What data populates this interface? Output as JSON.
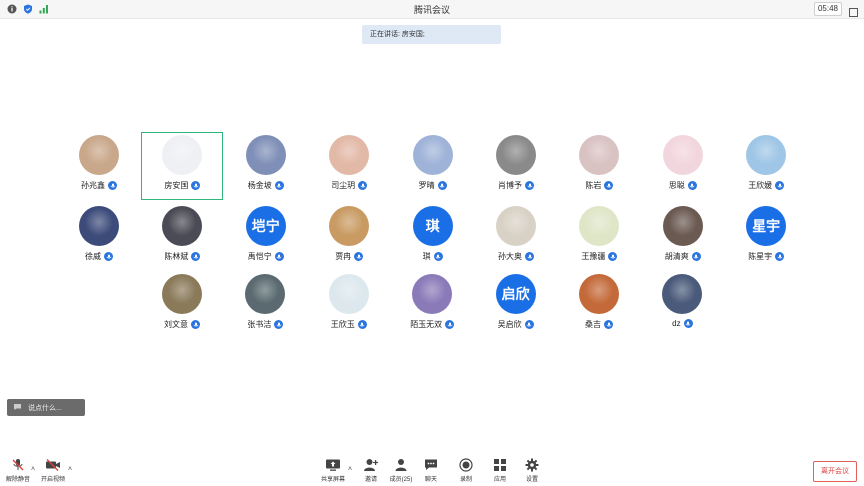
{
  "window": {
    "title": "腾讯会议",
    "timer": "05:48"
  },
  "speaking": {
    "text": "正在讲话: 房安国;"
  },
  "participants": [
    {
      "name": "孙兆鑫",
      "avatar": "photo",
      "active": false
    },
    {
      "name": "房安国",
      "avatar": "photo",
      "active": true
    },
    {
      "name": "杨金坡",
      "avatar": "photo",
      "active": false
    },
    {
      "name": "司尘玥",
      "avatar": "photo",
      "active": false
    },
    {
      "name": "罗晴",
      "avatar": "photo",
      "active": false
    },
    {
      "name": "肖博予",
      "avatar": "photo",
      "active": false
    },
    {
      "name": "陈岩",
      "avatar": "photo",
      "active": false
    },
    {
      "name": "思聪",
      "avatar": "photo",
      "active": false
    },
    {
      "name": "王欣媛",
      "avatar": "photo",
      "active": false
    },
    {
      "name": "徐威",
      "avatar": "photo",
      "active": false
    },
    {
      "name": "陈林斌",
      "avatar": "photo",
      "active": false
    },
    {
      "name": "禹恺宁",
      "avatar": "text",
      "avatar_text": "垲宁",
      "active": false
    },
    {
      "name": "贾冉",
      "avatar": "photo",
      "active": false
    },
    {
      "name": "琪",
      "avatar": "text",
      "avatar_text": "琪",
      "active": false
    },
    {
      "name": "孙大奥",
      "avatar": "photo",
      "active": false
    },
    {
      "name": "王豫疆",
      "avatar": "photo",
      "active": false
    },
    {
      "name": "胡清爽",
      "avatar": "photo",
      "active": false
    },
    {
      "name": "陈星宇",
      "avatar": "text",
      "avatar_text": "星宇",
      "active": false
    },
    {
      "name": "刘文意",
      "avatar": "photo",
      "active": false
    },
    {
      "name": "张书洁",
      "avatar": "photo",
      "active": false
    },
    {
      "name": "王欣玉",
      "avatar": "photo",
      "active": false
    },
    {
      "name": "陌玉无双",
      "avatar": "photo",
      "active": false
    },
    {
      "name": "吴启欣",
      "avatar": "text",
      "avatar_text": "启欣",
      "active": false
    },
    {
      "name": "桑吉",
      "avatar": "photo",
      "active": false
    },
    {
      "name": "dz",
      "avatar": "photo",
      "active": false
    }
  ],
  "chat_popup": {
    "text": "说点什么..."
  },
  "toolbar": {
    "unmute": "解除静音",
    "start_video": "开启视频",
    "share_screen": "共享屏幕",
    "invite": "邀请",
    "members": "成员(25)",
    "chat": "聊天",
    "record": "录制",
    "apps": "应用",
    "settings": "设置",
    "leave": "离开会议"
  },
  "colors": {
    "accent_blue": "#1b6fe6",
    "active_border": "#2db77a",
    "leave_red": "#d9403f",
    "mic_blue": "#2a74e0"
  }
}
